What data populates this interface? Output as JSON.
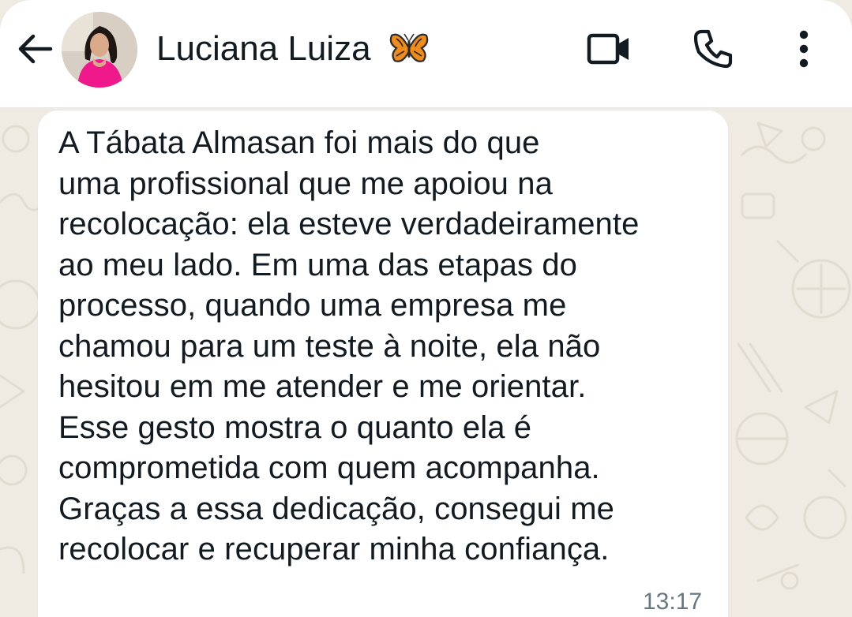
{
  "header": {
    "contact_name": "Luciana Luiza",
    "contact_emoji": "🦋",
    "back_icon": "arrow-left-icon",
    "video_icon": "video-camera-icon",
    "call_icon": "phone-icon",
    "menu_icon": "more-vertical-icon"
  },
  "message": {
    "lines": [
      "A Tábata Almasan foi mais do que",
      "uma profissional que me apoiou na",
      "recolocação: ela esteve verdadeiramente",
      "ao meu lado. Em uma das etapas do",
      "processo, quando uma empresa me",
      "chamou para um teste à noite, ela não",
      "hesitou em me atender e me orientar.",
      "Esse gesto mostra o quanto ela é",
      "comprometida com quem acompanha.",
      "Graças a essa dedicação, consegui me",
      "recolocar e recuperar minha confiança."
    ],
    "time": "13:17"
  },
  "colors": {
    "wallpaper": "#efeae2",
    "bubble": "#ffffff",
    "text": "#111b21",
    "timestamp": "#667781",
    "accent_avatar": "#f0198c"
  }
}
